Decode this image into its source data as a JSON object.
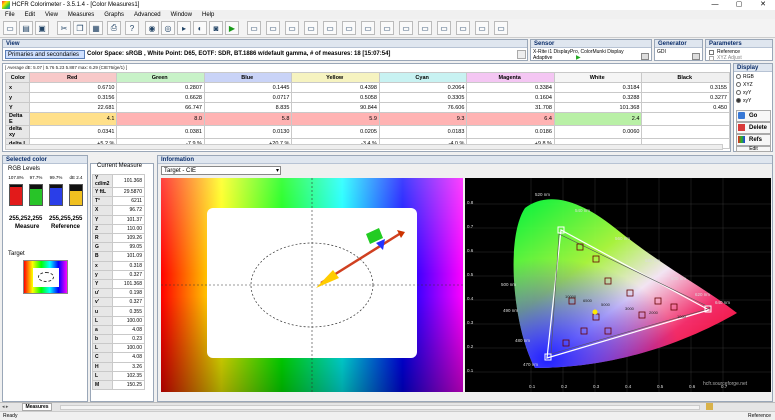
{
  "window": {
    "title": "HCFR Colorimeter - 3.5.1.4 - [Color Measures1]",
    "min": "—",
    "max": "▢",
    "close": "✕"
  },
  "menu": [
    "File",
    "Edit",
    "View",
    "Measures",
    "Graphs",
    "Advanced",
    "Window",
    "Help"
  ],
  "view_panel": {
    "title": "View",
    "select_value": "Primaries and secondaries",
    "info": "Color Space: sRGB , White Point: D65, EOTF:  SDR, BT.1886 w/default gamma, # of measures: 18 [15:07:54]"
  },
  "sensor_panel": {
    "title": "Sensor",
    "device": "X-Rite i1 DisplayPro, ColorMunki Display",
    "mode": "Adaptive"
  },
  "generator_panel": {
    "title": "Generator",
    "value": "GDI"
  },
  "parameters_panel": {
    "title": "Parameters",
    "reference_label": "Reference",
    "secondary_label": "XYZ Adjust"
  },
  "display_panel": {
    "title": "Display",
    "options": [
      "RGB",
      "XYZ",
      "xyY",
      "xyY"
    ],
    "go": "Go",
    "delete": "Delete",
    "refs": "Refs",
    "edit": "Edit"
  },
  "average_line": "[ Average dE: 5.07 | 5.76 5.23 5.887 max: 6.29 (CIE76/ge/1) ]",
  "measures": {
    "columns": [
      "Color",
      "Red",
      "Green",
      "Blue",
      "Yellow",
      "Cyan",
      "Magenta",
      "White",
      "Black"
    ],
    "header_colors": [
      "#e7e7e7",
      "#f8c9c9",
      "#c8f2c8",
      "#c9d3f7",
      "#f6f3c0",
      "#c8f2f2",
      "#f4c6f3",
      "#f5f5f5",
      "#f0f0f0"
    ],
    "rows": [
      {
        "label": "x",
        "values": [
          "0.6710",
          "0.2807",
          "0.1445",
          "0.4398",
          "0.2064",
          "0.3384",
          "0.3184",
          "0.3155"
        ]
      },
      {
        "label": "y",
        "values": [
          "0.3156",
          "0.6628",
          "0.0717",
          "0.5058",
          "0.3305",
          "0.1604",
          "0.3288",
          "0.3277"
        ]
      },
      {
        "label": "Y",
        "values": [
          "22.681",
          "66.747",
          "8.835",
          "90.844",
          "76.606",
          "31.708",
          "101.368",
          "0.450"
        ]
      },
      {
        "label": "Delta E",
        "values": [
          "4.1",
          "8.0",
          "5.8",
          "5.9",
          "9.3",
          "6.4",
          "2.4",
          ""
        ]
      },
      {
        "label": "delta xy",
        "values": [
          "0.0341",
          "0.0381",
          "0.0130",
          "0.0205",
          "0.0183",
          "0.0186",
          "0.0060",
          ""
        ]
      },
      {
        "label": "delta L",
        "values": [
          "+5.2 %",
          "-7.9 %",
          "+20.7 %",
          "-3.4 %",
          "-4.0 %",
          "+9.8 %",
          "",
          ""
        ]
      }
    ],
    "delta_e_colors": [
      "#ffe08a",
      "#ffb3b3",
      "#ffb3b3",
      "#ffb3b3",
      "#ffb3b3",
      "#ffb3b3",
      "#b9f0a6",
      "#ffffff"
    ]
  },
  "selected_color": {
    "title": "Selected color",
    "rgb_levels": "RGB Levels",
    "bars": [
      {
        "pct": "107.8%",
        "color": "#e21a1a",
        "fill": 0.9
      },
      {
        "pct": "97.7%",
        "color": "#28c428",
        "fill": 0.82
      },
      {
        "pct": "99.7%",
        "color": "#2a3ee8",
        "fill": 0.84
      },
      {
        "pct": "dE 2.4",
        "color": "#f0c020",
        "fill": 0.7
      }
    ],
    "measure_value": "255,252,255",
    "measure_label": "Measure",
    "reference_value": "255,255,255",
    "reference_label": "Reference",
    "target_label": "Target"
  },
  "current_measure": {
    "title": "Current Measure",
    "rows": [
      [
        "Y cd/m2",
        "101.368"
      ],
      [
        "Y ftL",
        "29.5870"
      ],
      [
        "T°",
        "6211"
      ],
      [
        "X",
        "96.72"
      ],
      [
        "Y",
        "101.37"
      ],
      [
        "Z",
        "110.00"
      ],
      [
        "R",
        "109.26"
      ],
      [
        "G",
        "99.05"
      ],
      [
        "B",
        "101.09"
      ],
      [
        "x",
        "0.318"
      ],
      [
        "y",
        "0.327"
      ],
      [
        "Y",
        "101.368"
      ],
      [
        "u'",
        "0.198"
      ],
      [
        "v'",
        "0.327"
      ],
      [
        "u",
        "0.355"
      ],
      [
        "L",
        "100.00"
      ],
      [
        "a",
        "4.08"
      ],
      [
        "b",
        "0.23"
      ],
      [
        "L",
        "100.00"
      ],
      [
        "C",
        "4.08"
      ],
      [
        "H",
        "3.26"
      ],
      [
        "L",
        "102.35"
      ],
      [
        "M",
        "150.25"
      ]
    ]
  },
  "information": {
    "title": "Information",
    "target_select": "Target - CIE",
    "watermark": "hcfr.sourceforge.net"
  },
  "cie": {
    "wl_labels": [
      "520 nm",
      "540 nm",
      "560 nm",
      "580 nm",
      "600 nm",
      "620 nm",
      "500 nm",
      "490 nm",
      "480 nm",
      "470 nm",
      "640 nm"
    ],
    "x_ticks": [
      "0.1",
      "0.2",
      "0.3",
      "0.4",
      "0.5",
      "0.6",
      "0.7"
    ],
    "y_ticks": [
      "0.8",
      "0.7",
      "0.6",
      "0.5",
      "0.4",
      "0.3",
      "0.2",
      "0.1"
    ],
    "temp_labels": [
      "10000",
      "6500",
      "5000",
      "3000",
      "2000",
      "1000"
    ]
  },
  "tabs": [
    "Measures"
  ],
  "status": {
    "left": "Ready",
    "right": "Reference"
  }
}
